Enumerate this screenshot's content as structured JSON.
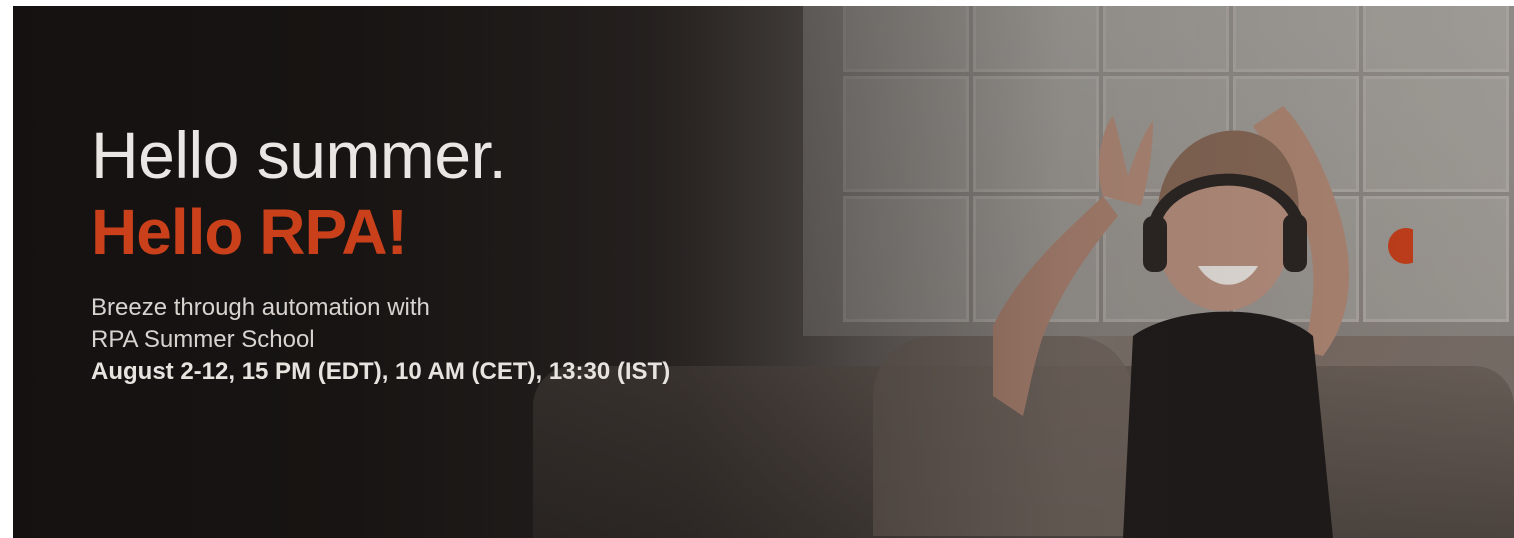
{
  "banner": {
    "headline_line1": "Hello summer.",
    "headline_line2": "Hello RPA!",
    "subtitle_line1": "Breeze through automation with",
    "subtitle_line2": "RPA Summer School",
    "schedule": "August 2-12, 15 PM (EDT), 10 AM (CET), 13:30 (IST)",
    "accent_color": "#c9401b"
  }
}
